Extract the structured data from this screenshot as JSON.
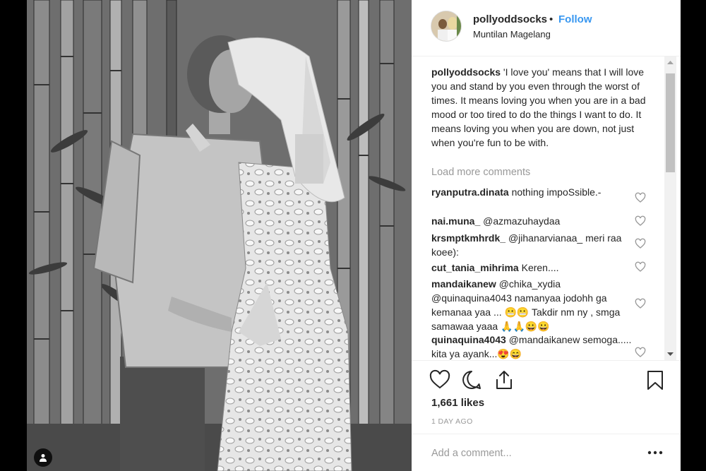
{
  "post": {
    "username": "pollyoddsocks",
    "separator": "•",
    "follow_label": "Follow",
    "location": "Muntilan Magelang"
  },
  "caption": {
    "username": "pollyoddsocks",
    "text": "'I love you' means that I will love you and stand by you even through the worst of times. It means loving you when you are in a bad mood or too tired to do the things I want to do. It means loving you when you are down, not just when you're fun to be with."
  },
  "load_more_label": "Load more comments",
  "comments": [
    {
      "username": "ryanputra.dinata",
      "text": "nothing impoSsible.-"
    },
    {
      "username": "nai.muna_",
      "text": "@azmazuhaydaa"
    },
    {
      "username": "krsmptkmhrdk_",
      "text": "@jihanarvianaa_ meri raa koee):"
    },
    {
      "username": "cut_tania_mihrima",
      "text": "Keren...."
    },
    {
      "username": "mandaikanew",
      "text": "@chika_xydia @quinaquina4043 namanyaa jodohh ga kemanaa yaa ... 😬😬 Takdir nm ny , smga samawaa yaaa 🙏🙏😀😀"
    },
    {
      "username": "quinaquina4043",
      "text": "@mandaikanew semoga..... kita ya ayank...😍😄"
    }
  ],
  "likes": "1,661 likes",
  "timestamp": "1 DAY AGO",
  "add_comment_placeholder": "Add a comment...",
  "icons": {
    "like": "heart-icon",
    "comment": "comment-icon",
    "share": "share-icon",
    "save": "bookmark-icon",
    "options": "more-options-icon",
    "tag": "user-tag-icon"
  },
  "colors": {
    "link_blue": "#3897f0",
    "text": "#262626",
    "muted": "#999999",
    "border": "#efefef"
  }
}
